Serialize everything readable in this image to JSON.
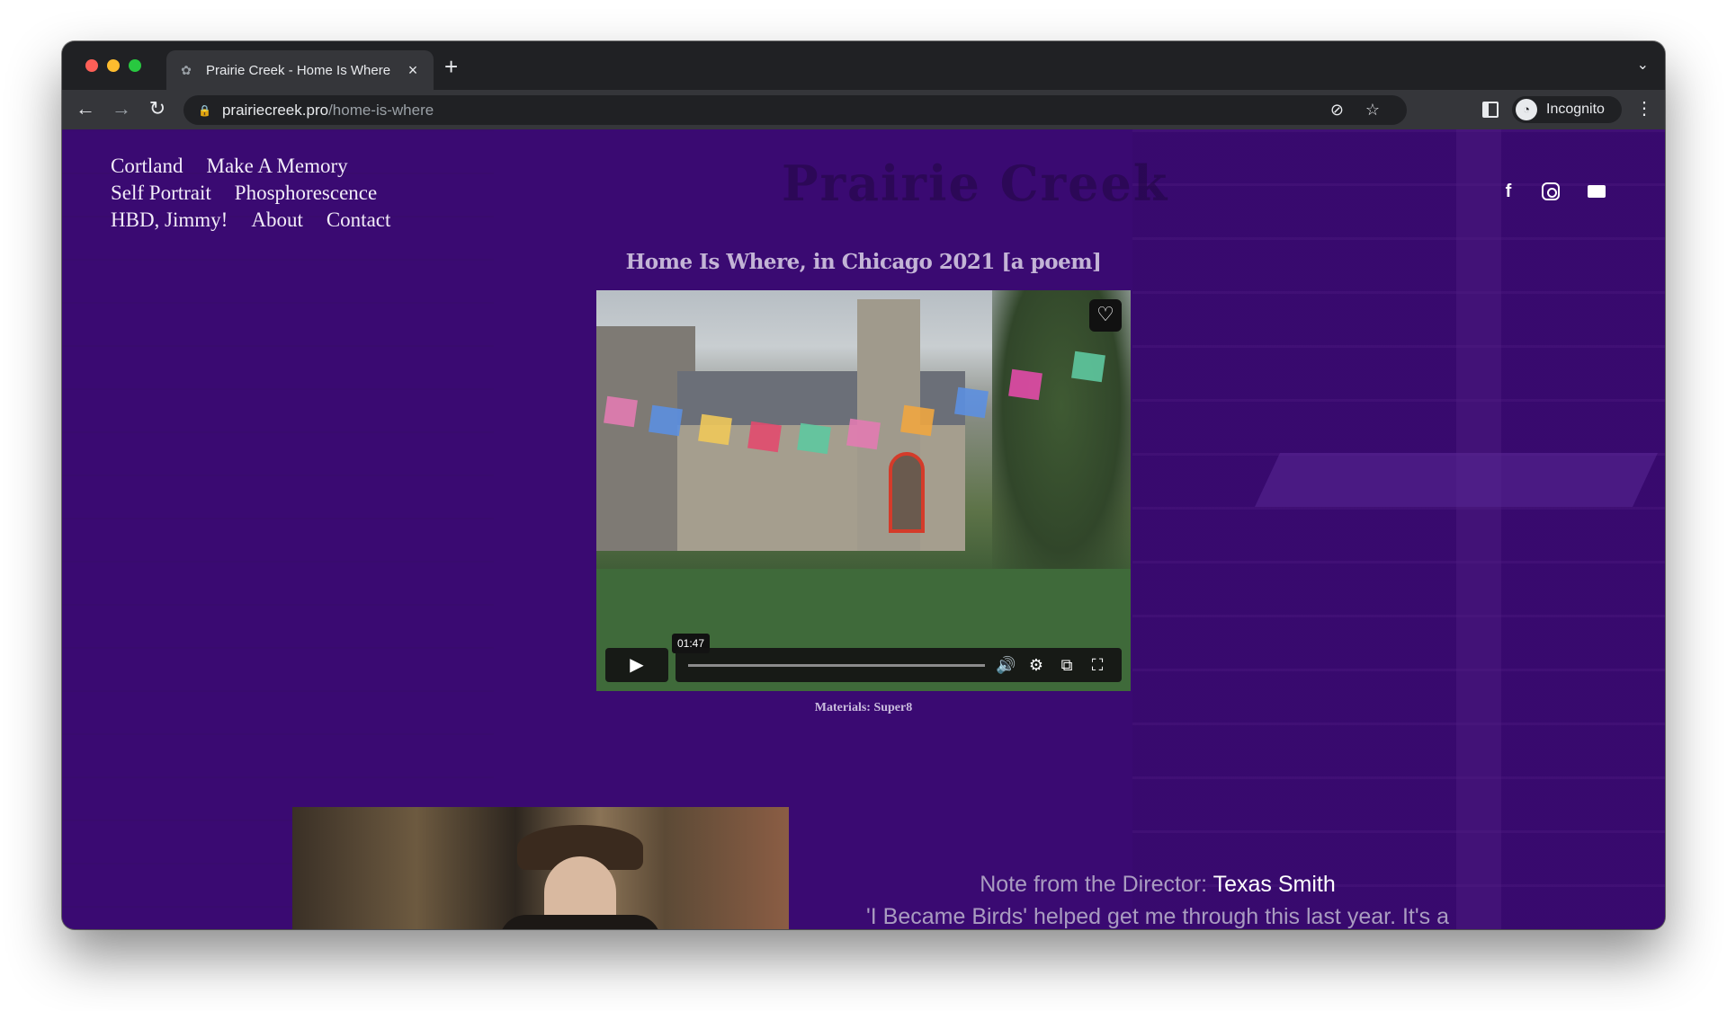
{
  "browser": {
    "tab_title": "Prairie Creek - Home Is Where",
    "url_host": "prairiecreek.pro",
    "url_path": "/home-is-where",
    "incognito_label": "Incognito"
  },
  "site": {
    "nav": [
      "Cortland",
      "Make A Memory",
      "Self Portrait",
      "Phosphorescence",
      "HBD, Jimmy!",
      "About",
      "Contact"
    ],
    "social_icons": [
      "facebook-icon",
      "instagram-icon",
      "mail-icon"
    ]
  },
  "post": {
    "title": "Home Is Where, in Chicago 2021 [a poem]",
    "video_time": "01:47",
    "caption": "Materials: Super8"
  },
  "note": {
    "prefix": "Note from the Director: ",
    "director": "Texas Smith",
    "quote": "'I Became Birds' helped get me through this last year. It's a"
  }
}
